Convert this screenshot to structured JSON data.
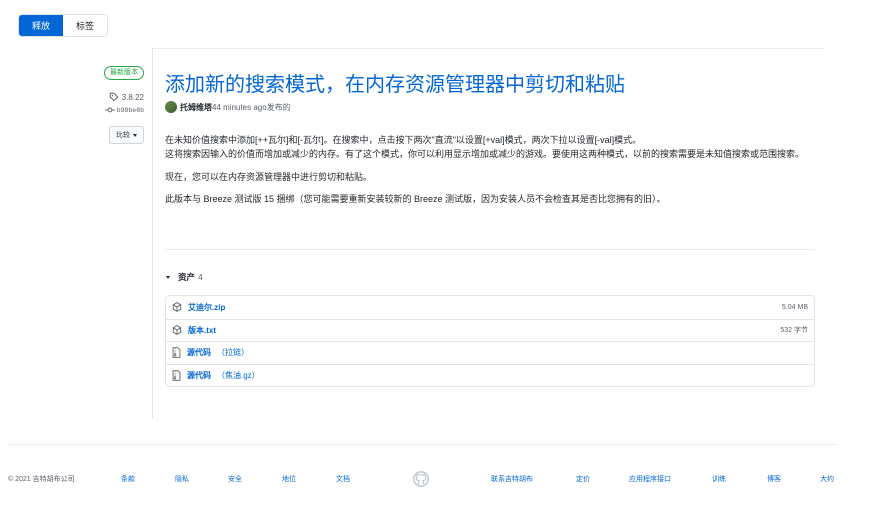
{
  "tabs": [
    {
      "label": "释放",
      "active": true
    },
    {
      "label": "标签",
      "active": false
    }
  ],
  "meta": {
    "badge": "最新版本",
    "tag": "3.8.22",
    "commit": "b98be8b",
    "compare_label": "比较"
  },
  "release": {
    "title": "添加新的搜索模式，在内存资源管理器中剪切和粘贴",
    "author": "托姆维塔",
    "published": "44 minutes ago发布的",
    "paragraphs": [
      "在未知价值搜索中添加[++瓦尔]和[-瓦尔]。在搜索中，点击按下两次\"直流\"以设置[+val]模式，两次下拉以设置[-val]模式。\n这将搜索因输入的价值而增加或减少的内存。有了这个模式，你可以利用显示增加或减少的游戏。要使用这两种模式，以前的搜索需要是未知值搜索或范围搜索。",
      "现在，您可以在内存资源管理器中进行剪切和粘贴。",
      "此版本与 Breeze 测试版 15 捆绑（您可能需要重新安装较新的 Breeze 测试版，因为安装人员不会检查其是否比您拥有的旧）。"
    ]
  },
  "assets": {
    "label": "资产",
    "count": "4",
    "items": [
      {
        "icon": "package-icon",
        "name": "艾迪尔.zip",
        "sub": "",
        "size": "5.04 MB"
      },
      {
        "icon": "package-icon",
        "name": "版本.txt",
        "sub": "",
        "size": "532 字节"
      },
      {
        "icon": "file-zip-icon",
        "name": "源代码",
        "sub": "（拉链）",
        "size": ""
      },
      {
        "icon": "file-zip-icon",
        "name": "源代码",
        "sub": "（焦油.gz）",
        "size": ""
      }
    ]
  },
  "footer": {
    "copyright": "© 2021 吉特胡布公司",
    "links_left": [
      "条款",
      "隐私",
      "安全",
      "地位",
      "文档"
    ],
    "links_right": [
      "联系吉特胡布",
      "定价",
      "应用程序接口",
      "训练",
      "博客",
      "大约"
    ]
  },
  "colors": {
    "accent": "#0366d6",
    "latest_green": "#28a745"
  }
}
